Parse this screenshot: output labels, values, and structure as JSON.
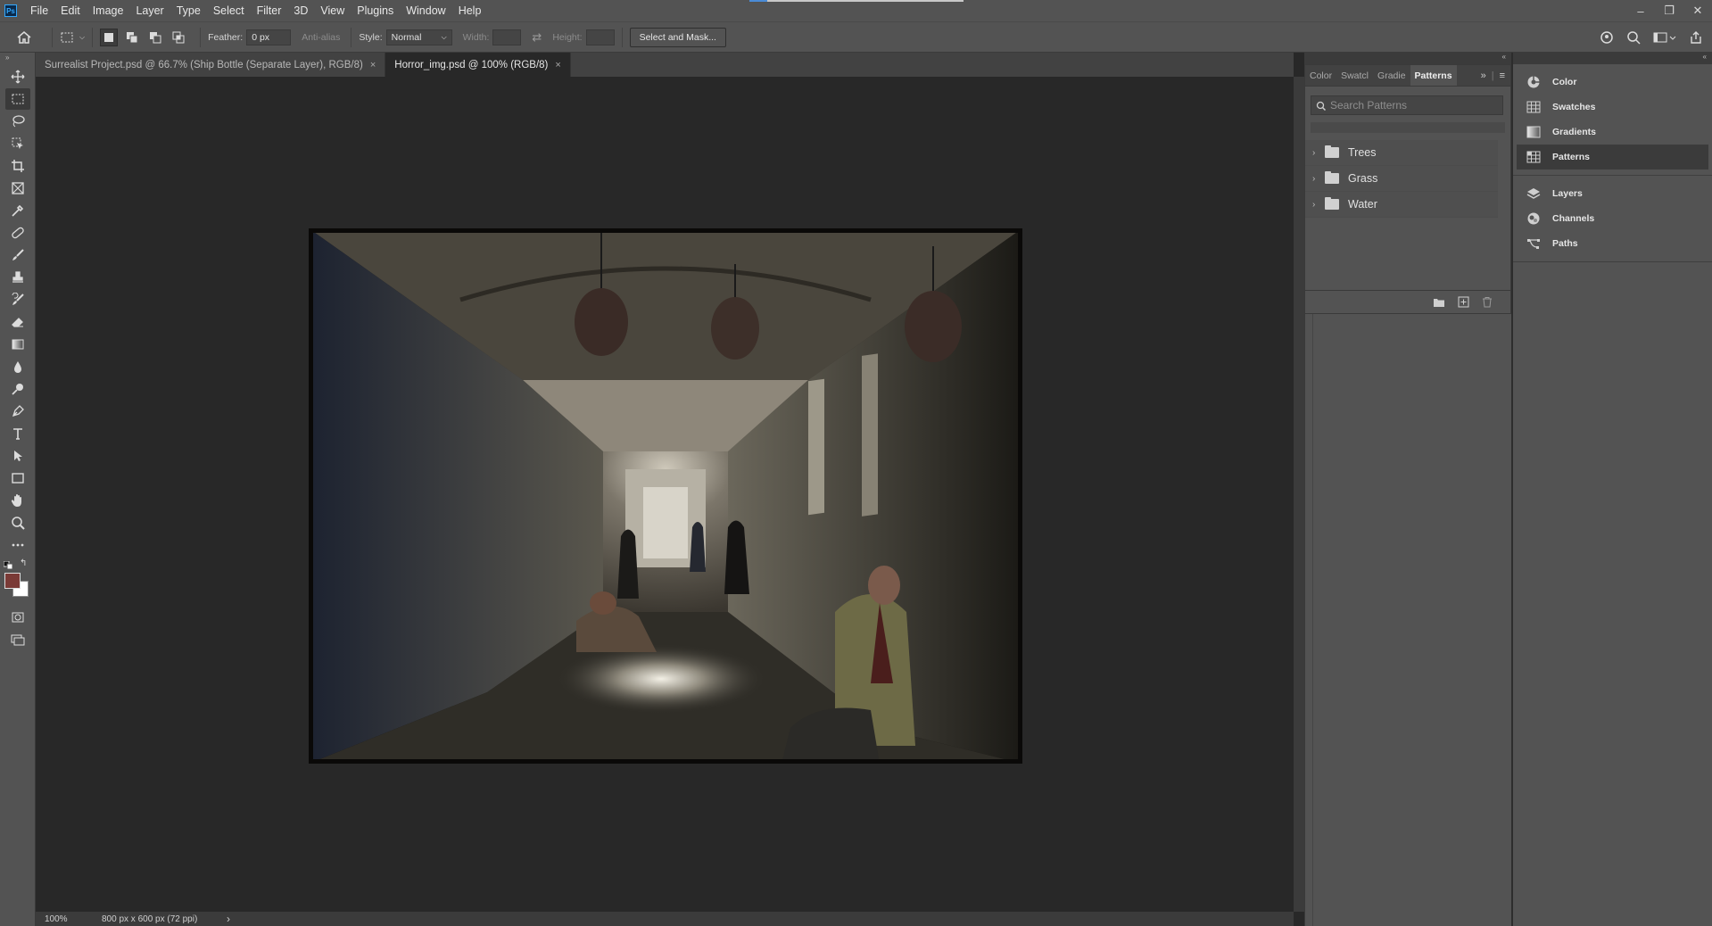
{
  "app": {
    "logo": "Ps"
  },
  "menu": [
    "File",
    "Edit",
    "Image",
    "Layer",
    "Type",
    "Select",
    "Filter",
    "3D",
    "View",
    "Plugins",
    "Window",
    "Help"
  ],
  "window_controls": {
    "minimize": "–",
    "restore": "❐",
    "close": "✕"
  },
  "options": {
    "feather_label": "Feather:",
    "feather_value": "0 px",
    "antialias_label": "Anti-alias",
    "style_label": "Style:",
    "style_value": "Normal",
    "width_label": "Width:",
    "height_label": "Height:",
    "select_mask_label": "Select and Mask..."
  },
  "tabs": [
    {
      "label": "Surrealist Project.psd @ 66.7% (Ship Bottle (Separate Layer), RGB/8)",
      "close": "×"
    },
    {
      "label": "Horror_img.psd @ 100% (RGB/8)",
      "close": "×"
    }
  ],
  "status": {
    "zoom": "100%",
    "doc_info": "800 px x 600 px (72 ppi)",
    "arrow": "›"
  },
  "patterns_panel": {
    "tabs": [
      "Color",
      "Swatcl",
      "Gradie",
      "Patterns"
    ],
    "search_placeholder": "Search Patterns",
    "groups": [
      "Trees",
      "Grass",
      "Water"
    ]
  },
  "dock": {
    "group1": [
      {
        "label": "Color",
        "icon": "color-wheel-icon"
      },
      {
        "label": "Swatches",
        "icon": "swatches-grid-icon"
      },
      {
        "label": "Gradients",
        "icon": "gradient-icon"
      },
      {
        "label": "Patterns",
        "icon": "patterns-grid-icon"
      }
    ],
    "group2": [
      {
        "label": "Layers",
        "icon": "layers-icon"
      },
      {
        "label": "Channels",
        "icon": "channels-icon"
      },
      {
        "label": "Paths",
        "icon": "paths-icon"
      }
    ]
  },
  "colors": {
    "foreground": "#7a3a36",
    "background": "#ffffff",
    "accent": "#31a8ff"
  }
}
